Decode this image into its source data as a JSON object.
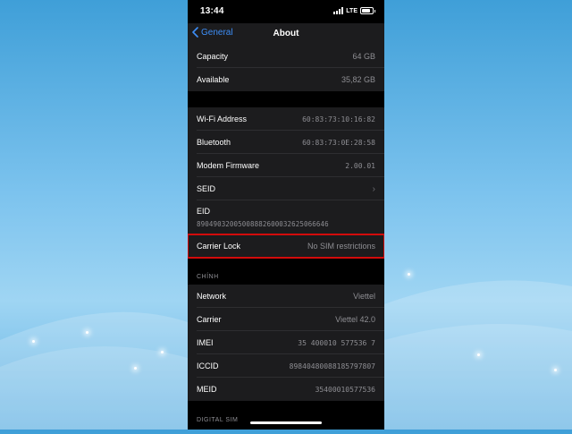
{
  "status_bar": {
    "time": "13:44",
    "network": "LTE"
  },
  "nav": {
    "back_label": "General",
    "title": "About"
  },
  "group1": [
    {
      "label": "Capacity",
      "value": "64 GB"
    },
    {
      "label": "Available",
      "value": "35,82 GB"
    }
  ],
  "group2": [
    {
      "label": "Wi-Fi Address",
      "value": "60:83:73:10:16:82"
    },
    {
      "label": "Bluetooth",
      "value": "60:83:73:0E:28:58"
    },
    {
      "label": "Modem Firmware",
      "value": "2.00.01"
    },
    {
      "label": "SEID",
      "value": ""
    }
  ],
  "eid": {
    "label": "EID",
    "value": "89049032005008882600032625066646"
  },
  "carrier_lock": {
    "label": "Carrier Lock",
    "value": "No SIM restrictions"
  },
  "section_primary": {
    "header": "CHÍNH"
  },
  "group3": [
    {
      "label": "Network",
      "value": "Viettel"
    },
    {
      "label": "Carrier",
      "value": "Viettel 42.0"
    },
    {
      "label": "IMEI",
      "value": "35 400010 577536 7"
    },
    {
      "label": "ICCID",
      "value": "89840480088185797807"
    },
    {
      "label": "MEID",
      "value": "35400010577536"
    }
  ],
  "section_digital": {
    "header": "DIGITAL SIM"
  },
  "colors": {
    "accent": "#3d8ef7",
    "highlight": "#d20b0b",
    "cell_bg": "#1c1c1e"
  }
}
